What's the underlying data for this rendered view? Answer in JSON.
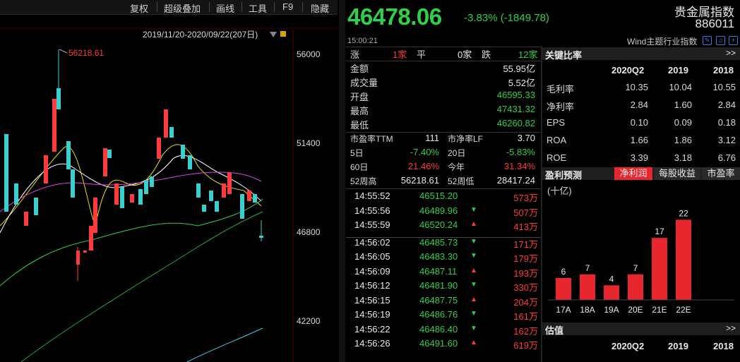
{
  "toolbar": {
    "items": [
      "复权",
      "超级叠加",
      "画线",
      "工具",
      "F9",
      "隐藏"
    ]
  },
  "chart": {
    "range_label": "2019/11/20-2020/09/22(207日)",
    "high_label": "56218.61",
    "y_ticks": [
      "56000",
      "51400",
      "46800",
      "42200"
    ]
  },
  "header": {
    "price": "46478.06",
    "change": "-3.83% (-1849.78)",
    "time": "15:00:21",
    "name": "贵金属指数",
    "code": "886011",
    "source": "Wind主题行业指数"
  },
  "breadth": {
    "up_label": "涨",
    "up": "1家",
    "flat_label": "平",
    "flat": "0家",
    "down_label": "跌",
    "down": "12家"
  },
  "quote": [
    {
      "label": "金额",
      "value": "55.95亿",
      "color": "white"
    },
    {
      "label": "成交量",
      "value": "5.52亿",
      "color": "white"
    },
    {
      "label": "开盘",
      "value": "46595.33",
      "color": "green"
    },
    {
      "label": "最高",
      "value": "47431.32",
      "color": "green"
    },
    {
      "label": "最低",
      "value": "46260.82",
      "color": "green"
    }
  ],
  "valuation_grid": [
    {
      "l1": "市盈率TTM",
      "v1": "111",
      "c1": "white",
      "l2": "市净率LF",
      "v2": "3.70",
      "c2": "white"
    },
    {
      "l1": "5日",
      "v1": "-7.40%",
      "c1": "green",
      "l2": "20日",
      "v2": "-5.83%",
      "c2": "green"
    },
    {
      "l1": "60日",
      "v1": "21.46%",
      "c1": "red",
      "l2": "今年",
      "v2": "31.34%",
      "c2": "red"
    },
    {
      "l1": "52周高",
      "v1": "56218.61",
      "c1": "white",
      "l2": "52周低",
      "v2": "28417.24",
      "c2": "white"
    }
  ],
  "ticks": [
    {
      "time": "14:55:52",
      "price": "46515.20",
      "dir": "",
      "vol": "573万"
    },
    {
      "time": "14:55:56",
      "price": "46489.96",
      "dir": "down",
      "vol": "507万"
    },
    {
      "time": "14:55:59",
      "price": "46520.24",
      "dir": "up",
      "vol": "413万"
    },
    {
      "time": "14:56:02",
      "price": "46485.73",
      "dir": "down",
      "vol": "171万"
    },
    {
      "time": "14:56:05",
      "price": "46483.30",
      "dir": "down",
      "vol": "179万"
    },
    {
      "time": "14:56:09",
      "price": "46487.11",
      "dir": "up",
      "vol": "193万"
    },
    {
      "time": "14:56:12",
      "price": "46481.90",
      "dir": "down",
      "vol": "330万"
    },
    {
      "time": "14:56:15",
      "price": "46487.75",
      "dir": "up",
      "vol": "204万"
    },
    {
      "time": "14:56:19",
      "price": "46486.76",
      "dir": "down",
      "vol": "161万"
    },
    {
      "time": "14:56:22",
      "price": "46486.40",
      "dir": "down",
      "vol": "162万"
    },
    {
      "time": "14:56:26",
      "price": "46491.60",
      "dir": "up",
      "vol": "619万"
    }
  ],
  "ratios": {
    "title": "关键比率",
    "more": ">>",
    "cols": [
      "2020Q2",
      "2019",
      "2018"
    ],
    "rows": [
      {
        "label": "毛利率",
        "vals": [
          "10.35",
          "10.04",
          "10.55"
        ]
      },
      {
        "label": "净利率",
        "vals": [
          "2.84",
          "1.60",
          "2.84"
        ]
      },
      {
        "label": "EPS",
        "vals": [
          "0.10",
          "0.09",
          "0.18"
        ]
      },
      {
        "label": "ROA",
        "vals": [
          "1.66",
          "1.86",
          "3.12"
        ]
      },
      {
        "label": "ROE",
        "vals": [
          "3.39",
          "3.18",
          "6.76"
        ]
      }
    ]
  },
  "forecast": {
    "title": "盈利预测",
    "tabs": [
      "净利润",
      "每股收益",
      "市盈率"
    ],
    "unit": "(十亿)",
    "bar_color": "#e8262d",
    "chart_data": {
      "type": "bar",
      "categories": [
        "17A",
        "18A",
        "19A",
        "20E",
        "21E",
        "22E"
      ],
      "values": [
        6,
        7,
        4,
        7,
        17,
        22
      ],
      "ylim": [
        0,
        24
      ]
    }
  },
  "estimate": {
    "title": "估值",
    "more": ">>",
    "cols": [
      "2020Q2",
      "2019",
      "2018"
    ]
  }
}
